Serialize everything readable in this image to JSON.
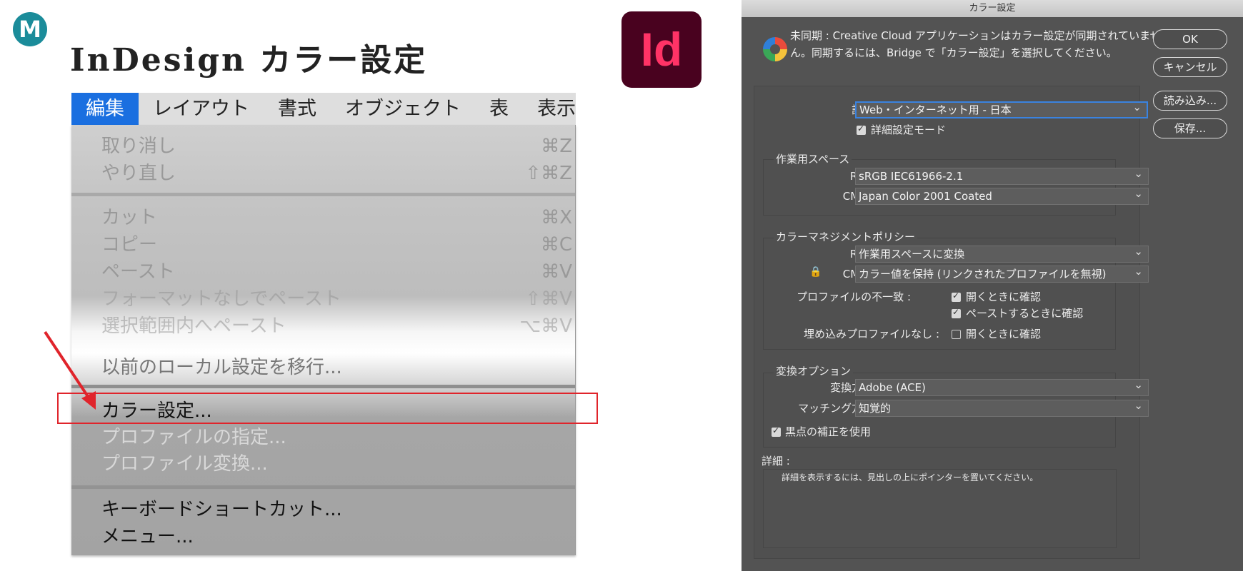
{
  "slide": {
    "badge": "M",
    "title": "InDesign カラー設定",
    "app_logo": "Id",
    "accent_color": "#1b8c9a",
    "highlight_color": "#e0242b"
  },
  "menubar": [
    {
      "label": "編集",
      "active": true
    },
    {
      "label": "レイアウト"
    },
    {
      "label": "書式"
    },
    {
      "label": "オブジェクト"
    },
    {
      "label": "表"
    },
    {
      "label": "表示"
    }
  ],
  "menu_items": {
    "undo": {
      "label": "取り消し",
      "shortcut": "⌘Z"
    },
    "redo": {
      "label": "やり直し",
      "shortcut": "⇧⌘Z"
    },
    "cut": {
      "label": "カット",
      "shortcut": "⌘X"
    },
    "copy": {
      "label": "コピー",
      "shortcut": "⌘C"
    },
    "paste": {
      "label": "ペースト",
      "shortcut": "⌘V"
    },
    "paste_no_format": {
      "label": "フォーマットなしでペースト",
      "shortcut": "⇧⌘V"
    },
    "paste_into": {
      "label": "選択範囲内へペースト",
      "shortcut": "⌥⌘V"
    },
    "migrate": {
      "label": "以前のローカル設定を移行..."
    },
    "color_settings": {
      "label": "カラー設定..."
    },
    "assign_profile": {
      "label": "プロファイルの指定..."
    },
    "convert_profile": {
      "label": "プロファイル変換..."
    },
    "shortcuts": {
      "label": "キーボードショートカット..."
    },
    "menus": {
      "label": "メニュー..."
    }
  },
  "dialog": {
    "title": "カラー設定",
    "sync_message": "未同期 : Creative Cloud アプリケーションはカラー設定が同期されていません。同期するには、Bridge で「カラー設定」を選択してください。",
    "buttons": {
      "ok": "OK",
      "cancel": "キャンセル",
      "load": "読み込み...",
      "save": "保存..."
    },
    "settings_label": "設定 :",
    "settings_value": "Web・インターネット用 - 日本",
    "advanced_mode": "詳細設定モード",
    "working_spaces": {
      "title": "作業用スペース",
      "rgb_label": "RGB :",
      "rgb_value": "sRGB IEC61966-2.1",
      "cmyk_label": "CMYK :",
      "cmyk_value": "Japan Color 2001 Coated"
    },
    "policies": {
      "title": "カラーマネジメントポリシー",
      "rgb_label": "RGB :",
      "rgb_value": "作業用スペースに変換",
      "cmyk_label": "CMYK :",
      "cmyk_value": "カラー値を保持 (リンクされたプロファイルを無視)",
      "mismatch_label": "プロファイルの不一致 :",
      "ask_open": "開くときに確認",
      "ask_paste": "ペーストするときに確認",
      "missing_label": "埋め込みプロファイルなし :",
      "missing_ask_open": "開くときに確認"
    },
    "conversion": {
      "title": "変換オプション",
      "engine_label": "変換方式 :",
      "engine_value": "Adobe (ACE)",
      "intent_label": "マッチング方法 :",
      "intent_value": "知覚的",
      "bpc": "黒点の補正を使用"
    },
    "description_label": "詳細 :",
    "description_text": "詳細を表示するには、見出しの上にポインターを置いてください。"
  }
}
